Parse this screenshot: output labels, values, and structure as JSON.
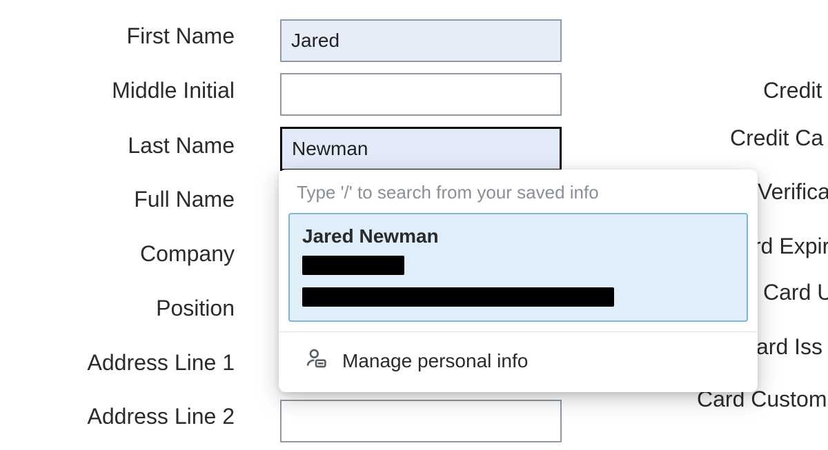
{
  "form": {
    "labels": {
      "first_name": "First Name",
      "middle_initial": "Middle Initial",
      "last_name": "Last Name",
      "full_name": "Full Name",
      "company": "Company",
      "position": "Position",
      "address1": "Address Line 1",
      "address2": "Address Line 2"
    },
    "values": {
      "first_name": "Jared",
      "middle_initial": "",
      "last_name": "Newman",
      "full_name": "",
      "company": "",
      "position": "",
      "address1": "",
      "address2": ""
    }
  },
  "right_labels": {
    "credit": "Credit",
    "credit_card": "Credit Ca",
    "verification": "Verifica",
    "card_expiry": "rd Expir",
    "card_u": "Card U",
    "card_iss": "ard Iss",
    "card_custom": "Card Custom"
  },
  "autofill": {
    "hint": "Type '/' to search from your saved info",
    "suggestion": {
      "name": "Jared Newman"
    },
    "manage_label": "Manage personal info"
  }
}
